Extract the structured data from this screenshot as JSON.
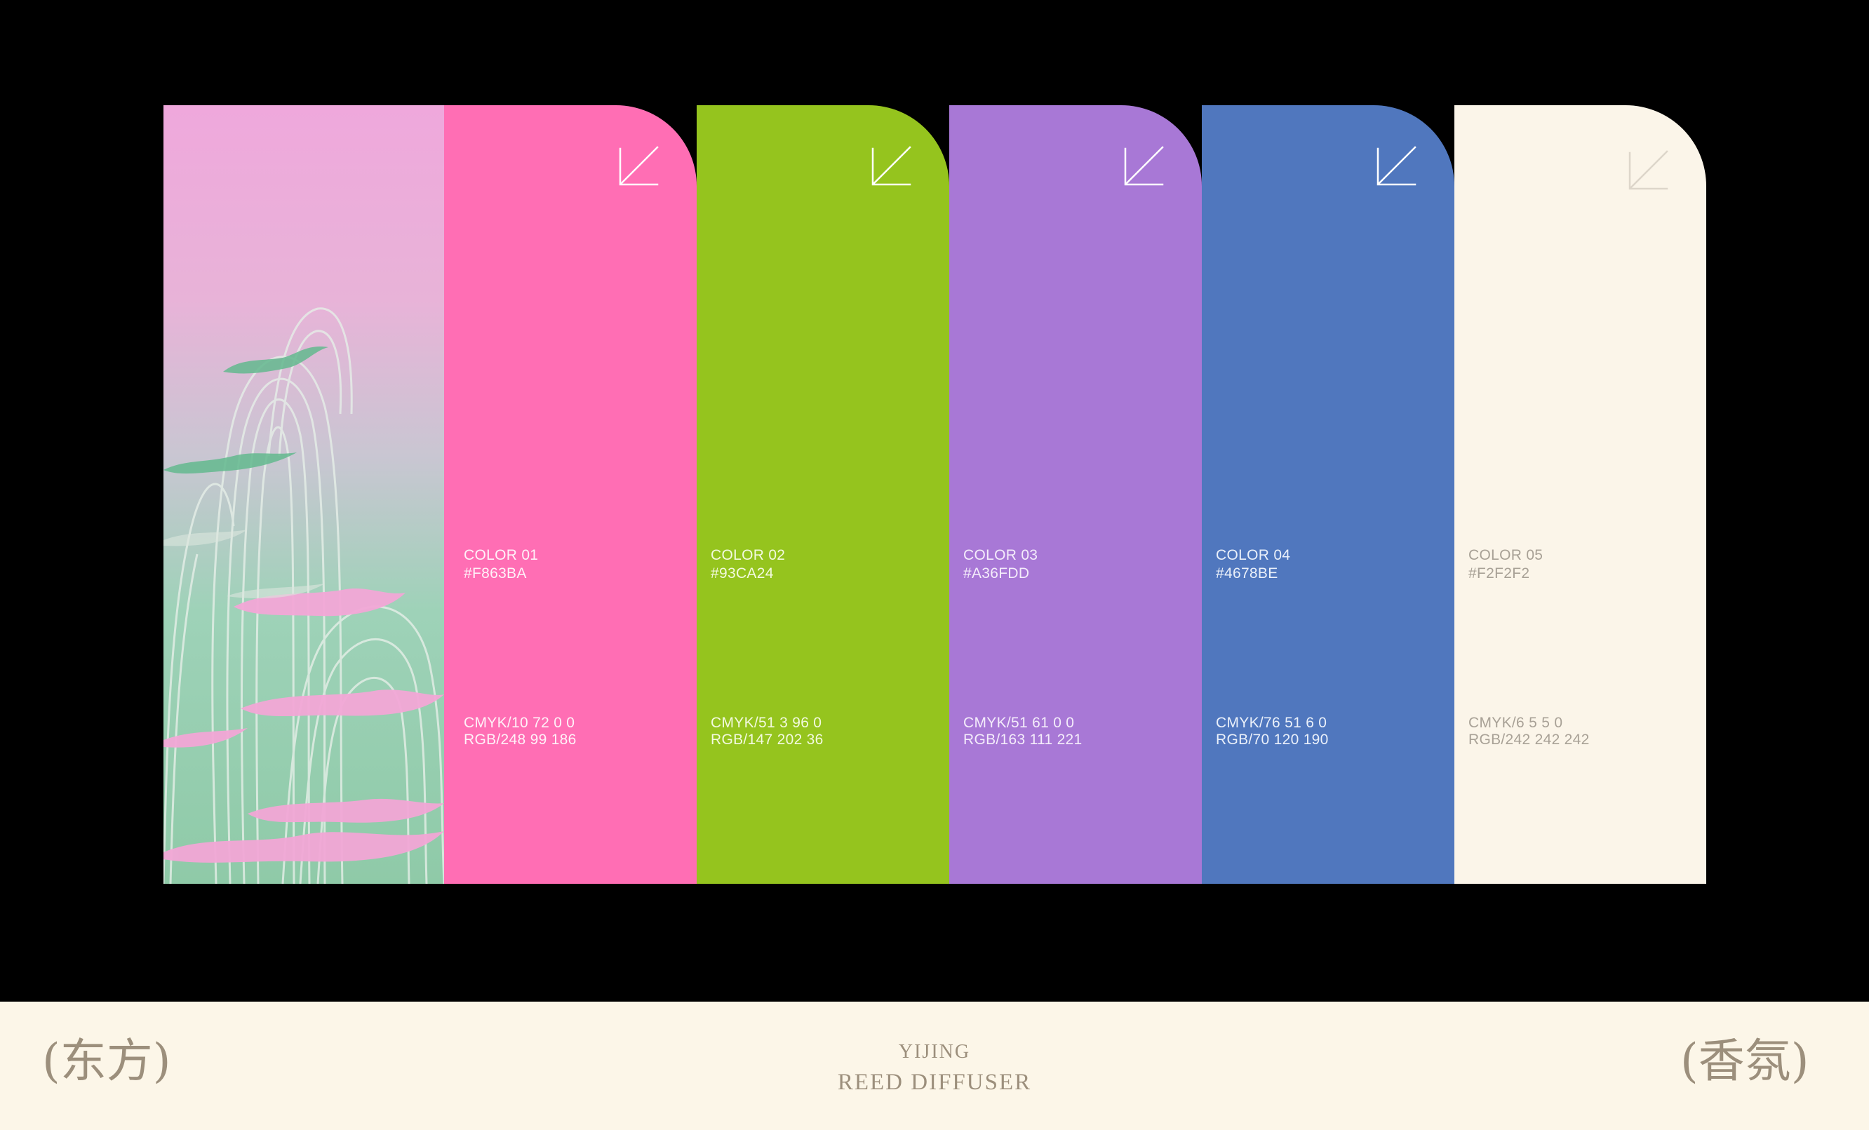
{
  "palette": [
    {
      "name": "COLOR 01",
      "hex": "#F863BA",
      "cmyk": "CMYK/10 72 0 0",
      "rgb": "RGB/248 99 186",
      "fill": "#ff6eb4",
      "text_color": "#fff1f8",
      "arrow_color": "#ffffff"
    },
    {
      "name": "COLOR 02",
      "hex": "#93CA24",
      "cmyk": "CMYK/51 3 96 0",
      "rgb": "RGB/147 202 36",
      "fill": "#95c41e",
      "text_color": "#f3fadf",
      "arrow_color": "#ffffff"
    },
    {
      "name": "COLOR 03",
      "hex": "#A36FDD",
      "cmyk": "CMYK/51 61 0 0",
      "rgb": "RGB/163 111 221",
      "fill": "#a878d6",
      "text_color": "#f4ecfb",
      "arrow_color": "#ffffff"
    },
    {
      "name": "COLOR 04",
      "hex": "#4678BE",
      "cmyk": "CMYK/76 51 6 0",
      "rgb": "RGB/70 120 190",
      "fill": "#5077be",
      "text_color": "#eaf0fa",
      "arrow_color": "#ffffff"
    },
    {
      "name": "COLOR 05",
      "hex": "#F2F2F2",
      "cmyk": "CMYK/6 5 5 0",
      "rgb": "RGB/242 242 242",
      "fill": "#fbf5e9",
      "text_color": "#a8a196",
      "arrow_color": "#ddd6ca"
    }
  ],
  "icons": {
    "arrow": "arrow-down-left-icon"
  },
  "footer": {
    "left_text": "(东方)",
    "right_text": "(香氛)",
    "brand_line1": "YIJING",
    "brand_line2": "REED DIFFUSER"
  }
}
